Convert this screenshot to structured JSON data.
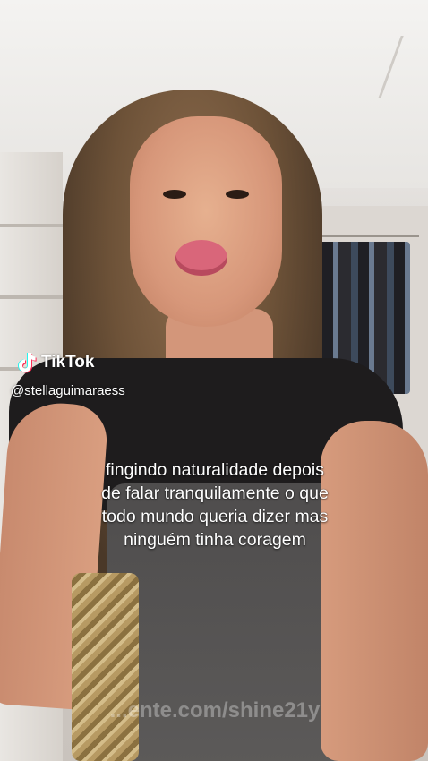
{
  "tiktok": {
    "logo_label": "TikTok",
    "handle": "@stellaguimaraess"
  },
  "caption": {
    "lines": [
      "fingindo naturalidade depois",
      "de falar tranquilamente o que",
      "todo mundo queria dizer mas",
      "ninguém tinha coragem"
    ]
  },
  "watermark": {
    "text": "...ente.com/shine21y"
  },
  "icons": {
    "logo": "tiktok-logo-icon"
  }
}
